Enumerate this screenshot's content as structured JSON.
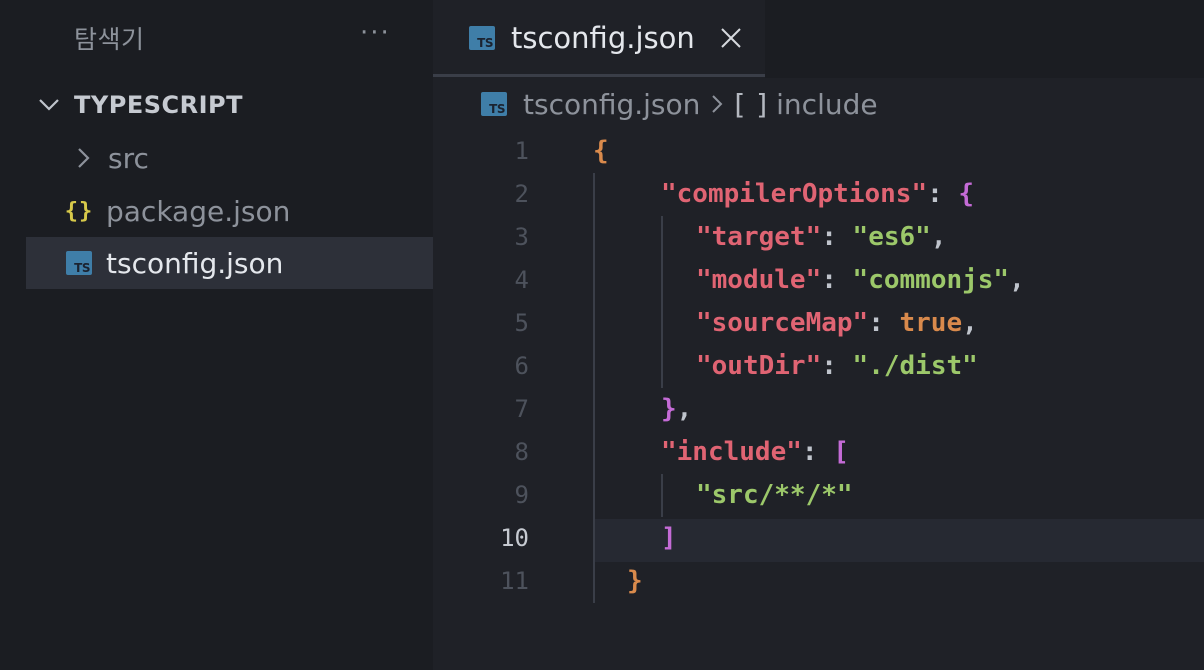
{
  "sidebar": {
    "title": "탐색기",
    "more_label": "···",
    "section": {
      "label": "TYPESCRIPT",
      "icon": "chevron-down-icon"
    },
    "items": [
      {
        "label": "src",
        "icon": "chevron-right-icon"
      },
      {
        "label": "package.json",
        "icon": "json-braces-icon",
        "icon_text": "{}"
      },
      {
        "label": "tsconfig.json",
        "icon": "typescript-file-icon",
        "icon_text": "TS",
        "selected": true
      }
    ]
  },
  "tab": {
    "label": "tsconfig.json",
    "icon": "typescript-file-icon",
    "icon_text": "TS",
    "close_icon": "close-icon"
  },
  "breadcrumb": {
    "file": "tsconfig.json",
    "separator_icon": "chevron-right-icon",
    "bracket": "[ ]",
    "property": "include"
  },
  "editor": {
    "active_line": 10,
    "line_numbers": [
      "1",
      "2",
      "3",
      "4",
      "5",
      "6",
      "7",
      "8",
      "9",
      "10",
      "11"
    ],
    "tokens": {
      "l1_open": "{",
      "l2_key": "\"compilerOptions\"",
      "l2_colon": ": ",
      "l2_open": "{",
      "l3_key": "\"target\"",
      "l3_colon": ": ",
      "l3_val": "\"es6\"",
      "l3_comma": ",",
      "l4_key": "\"module\"",
      "l4_colon": ": ",
      "l4_val": "\"commonjs\"",
      "l4_comma": ",",
      "l5_key": "\"sourceMap\"",
      "l5_colon": ": ",
      "l5_val": "true",
      "l5_comma": ",",
      "l6_key": "\"outDir\"",
      "l6_colon": ": ",
      "l6_val": "\"./dist\"",
      "l7_close": "}",
      "l7_comma": ",",
      "l8_key": "\"include\"",
      "l8_colon": ": ",
      "l8_open": "[",
      "l9_val": "\"src/**/*\"",
      "l10_close": "]",
      "l11_close": "}"
    }
  },
  "colors": {
    "key": "#e06473",
    "string": "#9cc86a",
    "brace": "#d98a4c",
    "bracket": "#c46bd6",
    "ts_badge": "#3f7ea8",
    "json_icon": "#d7c94a"
  }
}
